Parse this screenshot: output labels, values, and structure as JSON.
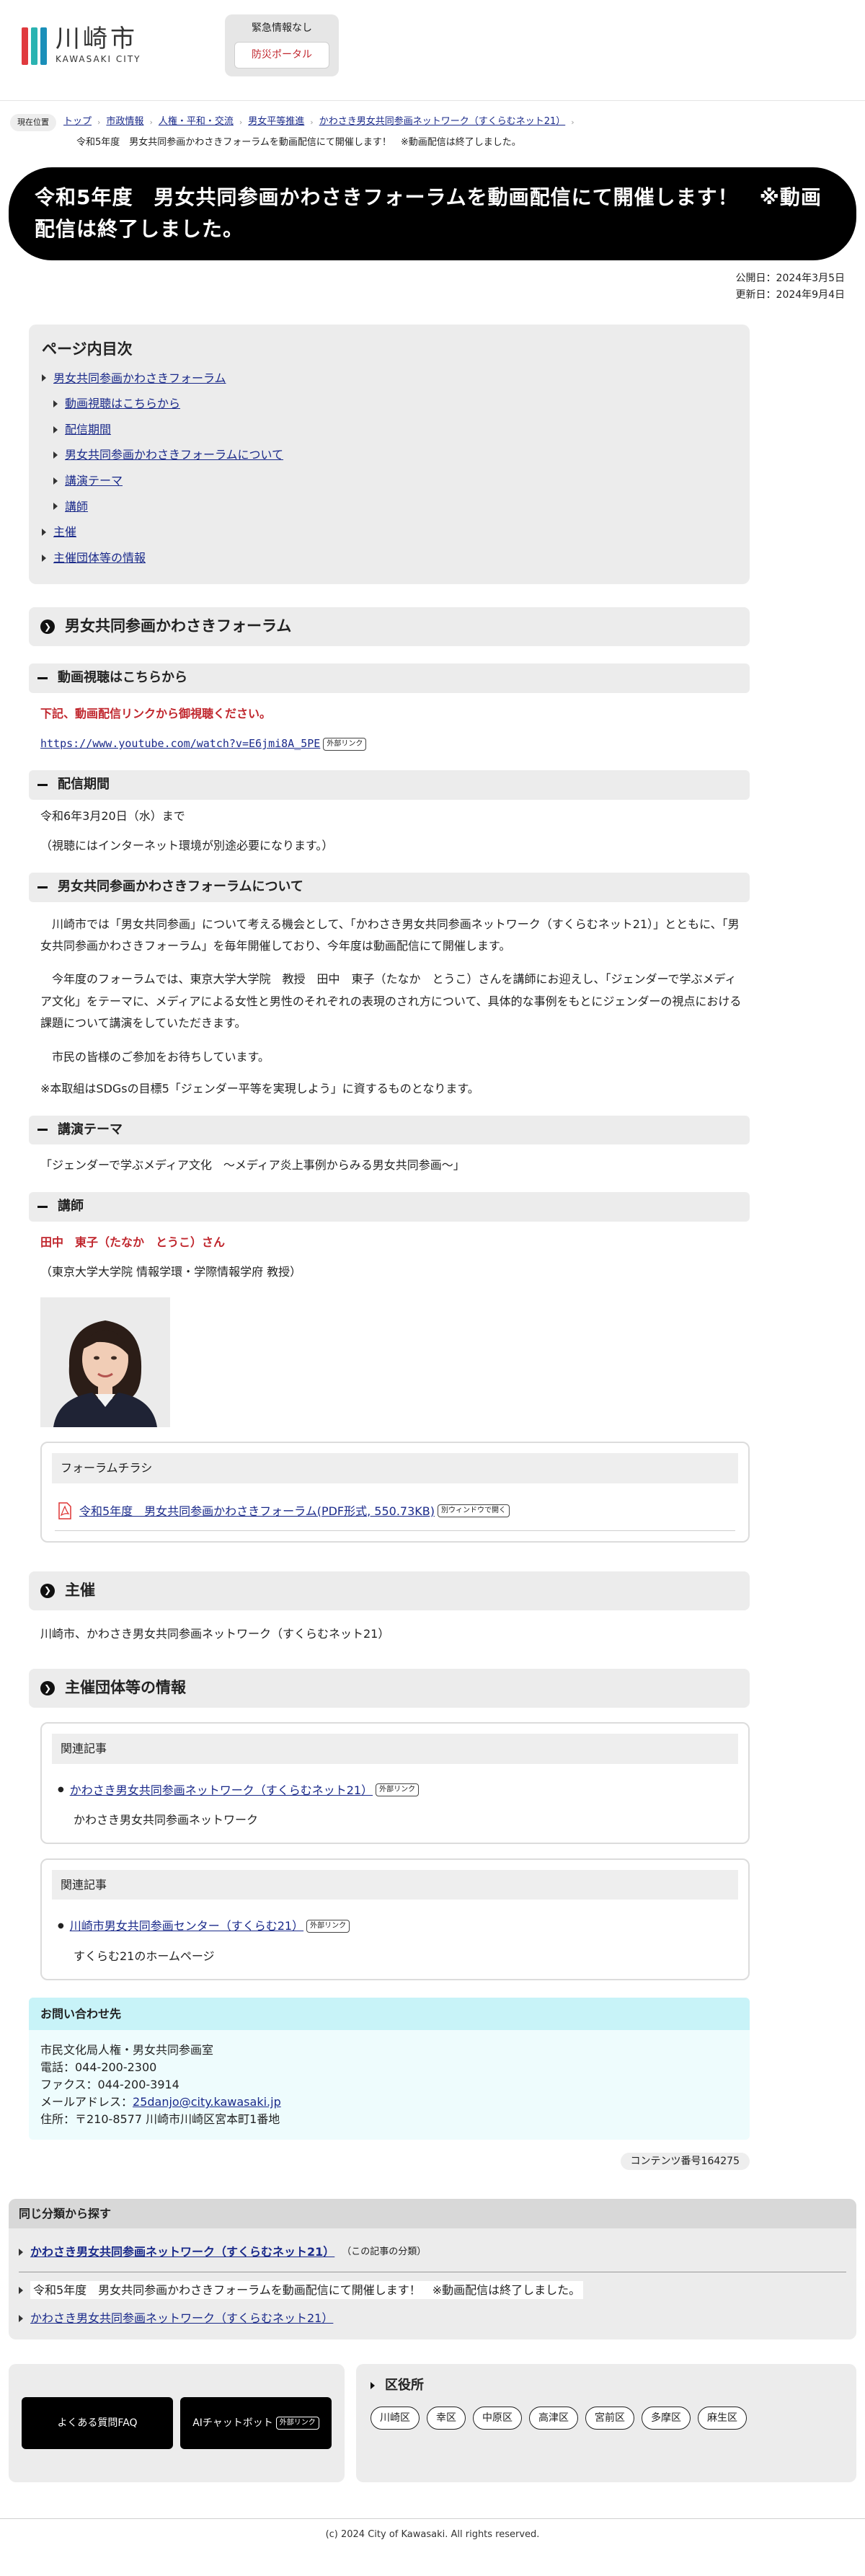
{
  "header": {
    "logo_jp": "川崎市",
    "logo_en": "KAWASAKI CITY",
    "logo_colors": [
      "#e03a3e",
      "#2bb3b1",
      "#1a8fb9"
    ],
    "emergency_title": "緊急情報なし",
    "bousai_label": "防災ポータル"
  },
  "breadcrumb": {
    "here_label": "現在位置",
    "items": [
      "トップ",
      "市政情報",
      "人権・平和・交流",
      "男女平等推進",
      "かわさき男女共同参画ネットワーク（すくらむネット21）"
    ],
    "current": "令和5年度　男女共同参画かわさきフォーラムを動画配信にて開催します！　※動画配信は終了しました。"
  },
  "page": {
    "title": "令和5年度　男女共同参画かわさきフォーラムを動画配信にて開催します！　※動画配信は終了しました。",
    "published": "公開日：2024年3月5日",
    "updated": "更新日：2024年9月4日"
  },
  "toc": {
    "title": "ページ内目次",
    "items": [
      {
        "label": "男女共同参画かわさきフォーラム",
        "level": 1
      },
      {
        "label": "動画視聴はこちらから",
        "level": 2
      },
      {
        "label": "配信期間",
        "level": 2
      },
      {
        "label": "男女共同参画かわさきフォーラムについて",
        "level": 2
      },
      {
        "label": "講演テーマ",
        "level": 2
      },
      {
        "label": "講師",
        "level": 2
      },
      {
        "label": "主催",
        "level": 1
      },
      {
        "label": "主催団体等の情報",
        "level": 1
      }
    ]
  },
  "forum": {
    "heading": "男女共同参画かわさきフォーラム",
    "video_heading": "動画視聴はこちらから",
    "video_notice": "下記、動画配信リンクから御視聴ください。",
    "video_url": "https://www.youtube.com/watch?v=E6jmi8A_5PE",
    "external_label": "外部リンク",
    "period_heading": "配信期間",
    "period_text": "令和6年3月20日（水）まで",
    "period_note": "（視聴にはインターネット環境が別途必要になります。）",
    "about_heading": "男女共同参画かわさきフォーラムについて",
    "about_p1": "川崎市では「男女共同参画」について考える機会として、「かわさき男女共同参画ネットワーク（すくらむネット21）」とともに、「男女共同参画かわさきフォーラム」を毎年開催しており、今年度は動画配信にて開催します。",
    "about_p2": "今年度のフォーラムでは、東京大学大学院　教授　田中　東子（たなか　とうこ）さんを講師にお迎えし、「ジェンダーで学ぶメディア文化」をテーマに、メディアによる女性と男性のそれぞれの表現のされ方について、具体的な事例をもとにジェンダーの視点における課題について講演をしていただきます。",
    "about_p3": "市民の皆様のご参加をお待ちしています。",
    "about_p4": "※本取組はSDGsの目標5「ジェンダー平等を実現しよう」に資するものとなります。",
    "theme_heading": "講演テーマ",
    "theme_text": "「ジェンダーで学ぶメディア文化　～メディア炎上事例からみる男女共同参画～」",
    "lecturer_heading": "講師",
    "lecturer_name": "田中　東子（たなか　とうこ）さん",
    "lecturer_affiliation": "（東京大学大学院 情報学環・学際情報学府 教授）",
    "flyer_box_title": "フォーラムチラシ",
    "flyer_link": "令和5年度　男女共同参画かわさきフォーラム(PDF形式, 550.73KB)",
    "new_window_label": "別ウィンドウで開く"
  },
  "organizer": {
    "heading": "主催",
    "text": "川崎市、かわさき男女共同参画ネットワーク（すくらむネット21）"
  },
  "org_info": {
    "heading": "主催団体等の情報",
    "boxes": [
      {
        "title": "関連記事",
        "link": "かわさき男女共同参画ネットワーク（すくらむネット21）",
        "desc": "かわさき男女共同参画ネットワーク"
      },
      {
        "title": "関連記事",
        "link": "川崎市男女共同参画センター（すくらむ21）",
        "desc": "すくらむ21のホームページ"
      }
    ]
  },
  "contact": {
    "heading": "お問い合わせ先",
    "dept": "市民文化局人権・男女共同参画室",
    "tel": "電話：044-200-2300",
    "fax": "ファクス：044-200-3914",
    "email_label": "メールアドレス：",
    "email": "25danjo@city.kawasaki.jp",
    "address": "住所：〒210-8577 川崎市川崎区宮本町1番地"
  },
  "content_no": "コンテンツ番号164275",
  "same_category": {
    "heading": "同じ分類から探す",
    "category": "かわさき男女共同参画ネットワーク（すくらむネット21）",
    "category_note": "（この記事の分類）",
    "current": "令和5年度　男女共同参画かわさきフォーラムを動画配信にて開催します！　※動画配信は終了しました。",
    "other": "かわさき男女共同参画ネットワーク（すくらむネット21）"
  },
  "bottom_nav": {
    "faq_label": "よくある質問FAQ",
    "ai_label": "AIチャットボット",
    "ward_title": "区役所",
    "wards": [
      "川崎区",
      "幸区",
      "中原区",
      "高津区",
      "宮前区",
      "多摩区",
      "麻生区"
    ]
  },
  "footer": {
    "copyright": "(c) 2024 City of Kawasaki. All rights reserved."
  }
}
